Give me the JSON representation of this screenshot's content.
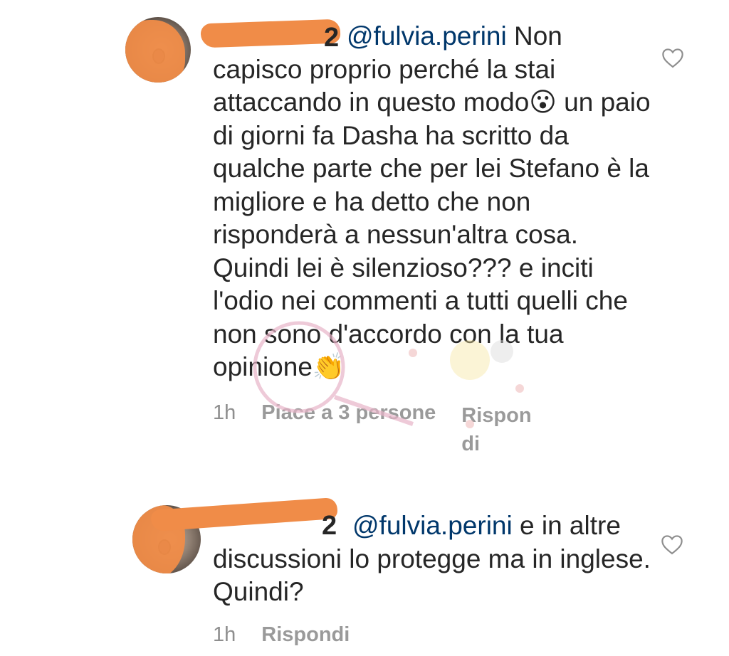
{
  "comments": [
    {
      "username_suffix": "2",
      "mention": "@fulvia.perini",
      "text": " Non capisco proprio perché la stai attaccando in questo modo😮 un paio di giorni fa Dasha ha scritto da qualche parte che per lei Stefano è la migliore e ha detto che non risponderà a nessun'altra cosa. Quindi lei è silenzioso??? e inciti l'odio nei commenti a tutti quelli che non sono d'accordo con la tua opinione👏",
      "time": "1h",
      "likes": "Piace a 3 persone",
      "reply": "Rispondi"
    },
    {
      "username_suffix": "2",
      "mention": "@fulvia.perini",
      "text": " e in altre discussioni lo protegge ma in inglese. Quindi?",
      "time": "1h",
      "reply": "Rispondi"
    }
  ],
  "icons": {
    "like": "heart-outline-icon",
    "watermark": "watermark-logo"
  },
  "colors": {
    "redaction": "#f08c48",
    "mention": "#00376b",
    "meta": "#8e8e8e"
  }
}
